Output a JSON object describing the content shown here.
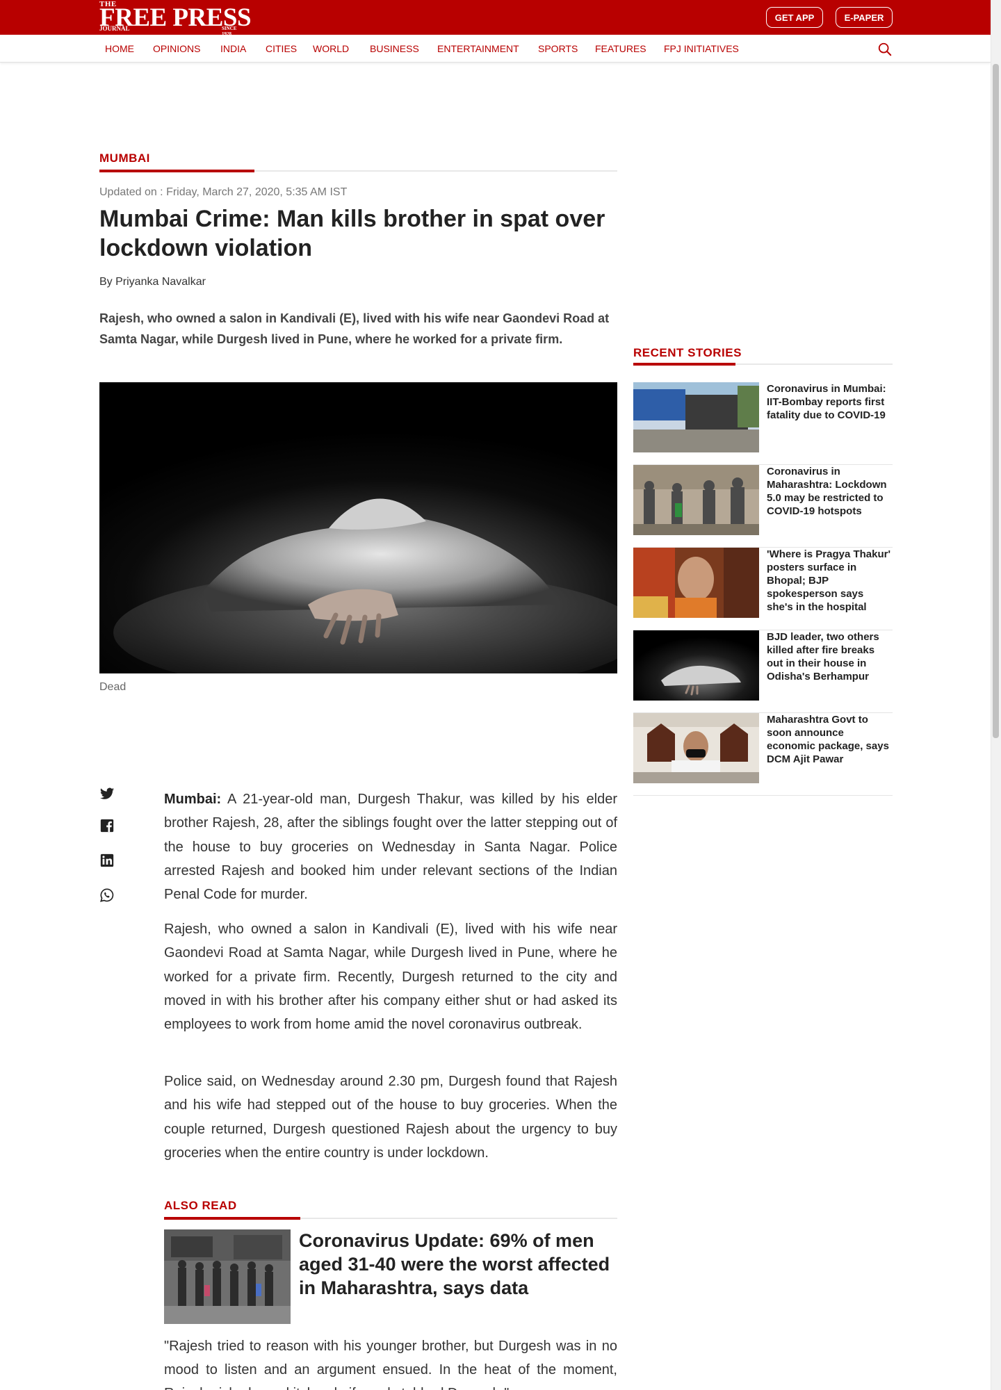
{
  "header": {
    "logo": {
      "the": "THE",
      "main": "FREE PRESS",
      "journal": "JOURNAL",
      "since": "SINCE 1928"
    },
    "get_app": "GET APP",
    "epaper": "E-PAPER",
    "accent_color": "#b80000"
  },
  "nav": {
    "items": [
      "HOME",
      "OPINIONS",
      "INDIA",
      "CITIES",
      "WORLD",
      "BUSINESS",
      "ENTERTAINMENT",
      "SPORTS",
      "FEATURES",
      "FPJ INITIATIVES"
    ],
    "search_icon": "search-icon"
  },
  "article": {
    "section": "MUMBAI",
    "updated": "Updated on : Friday, March 27, 2020, 5:35 AM IST",
    "headline": "Mumbai Crime: Man kills brother in spat over lockdown violation",
    "byline": "By Priyanka Navalkar",
    "summary": "Rajesh, who owned a salon in Kandivali (E), lived with his wife near Gaondevi Road at Samta Nagar, while Durgesh lived in Pune, where he worked for a private firm.",
    "image_caption": "Dead",
    "dateline": "Mumbai:",
    "p1": " A 21-year-old man, Durgesh Thakur, was killed by his elder brother Rajesh, 28, after the siblings fought over the latter stepping out of the house to buy groceries on Wednesday in Santa Nagar. Police arrested Rajesh and booked him under relevant sections of the Indian Penal Code for murder.",
    "p2": "Rajesh, who owned a salon in Kandivali (E), lived with his wife near Gaondevi Road at Samta Nagar, while Durgesh lived in Pune, where he worked for a private firm. Recently, Durgesh returned to the city and moved in with his brother after his company either shut or had asked its employees to work from home amid the novel coronavirus outbreak.",
    "p3": "Police said, on Wednesday around 2.30 pm, Durgesh found that Rajesh and his wife had stepped out of the house to buy groceries. When the couple returned, Durgesh questioned Rajesh about the urgency to buy groceries when the entire country is under lockdown.",
    "also_read_label": "ALSO READ",
    "also_read_title": "Coronavirus Update: 69% of men aged 31-40 were the worst affected in Maharashtra, says data",
    "p4": "\"Rajesh tried to reason with his younger brother, but Durgesh was in no mood to listen and an argument ensued. In the heat of the moment, Rajesh picked up a kitchen knife and stabbed Durgesh,\""
  },
  "share_icons": [
    "twitter-icon",
    "facebook-icon",
    "linkedin-icon",
    "whatsapp-icon"
  ],
  "recent": {
    "label": "RECENT STORIES",
    "items": [
      {
        "title": "Coronavirus in Mumbai: IIT-Bombay reports first fatality due to COVID-19"
      },
      {
        "title": "Coronavirus in Maharashtra: Lockdown 5.0 may be restricted to COVID-19 hotspots"
      },
      {
        "title": "'Where is Pragya Thakur' posters surface in Bhopal; BJP spokesperson says she's in the hospital"
      },
      {
        "title": "BJD leader, two others killed after fire breaks out in their house in Odisha's Berhampur"
      },
      {
        "title": "Maharashtra Govt to soon announce economic package, says DCM Ajit Pawar"
      }
    ]
  }
}
